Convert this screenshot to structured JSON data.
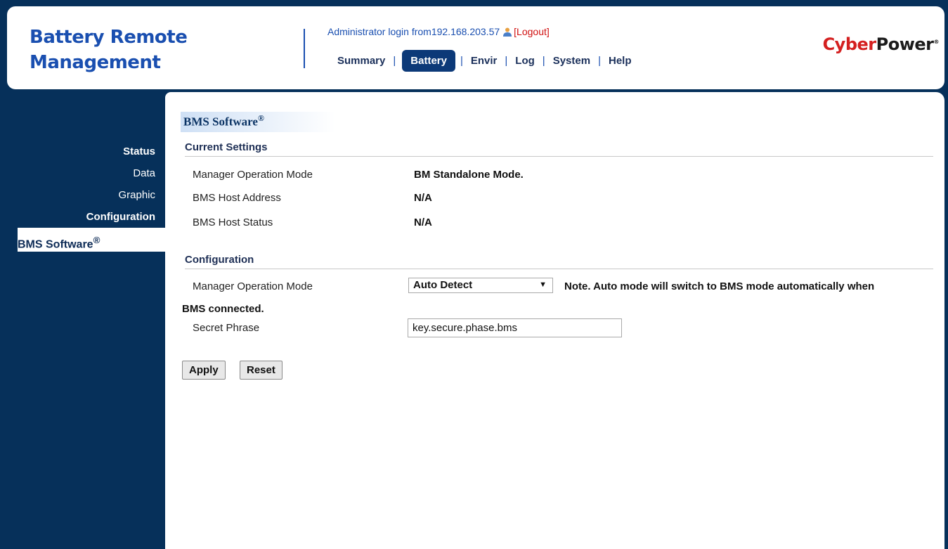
{
  "header": {
    "brand_line1": "Battery Remote",
    "brand_line2": "Management",
    "login_text": "Administrator login from192.168.203.57",
    "logout_label": "[Logout]",
    "logo_cyber": "Cyber",
    "logo_power": "Power",
    "logo_mark": "®"
  },
  "nav": {
    "summary": "Summary",
    "battery": "Battery",
    "envir": "Envir",
    "log": "Log",
    "system": "System",
    "help": "Help",
    "separator": "|"
  },
  "sidebar": {
    "status": "Status",
    "data": "Data",
    "graphic": "Graphic",
    "configuration": "Configuration",
    "bms_software": "BMS Software",
    "reg": "®"
  },
  "content": {
    "title": "BMS Software",
    "title_reg": "®",
    "current_settings": {
      "heading": "Current Settings",
      "rows": [
        {
          "label": "Manager Operation Mode",
          "value": "BM Standalone Mode."
        },
        {
          "label": "BMS Host Address",
          "value": "N/A"
        },
        {
          "label": "BMS Host Status",
          "value": "N/A"
        }
      ]
    },
    "configuration": {
      "heading": "Configuration",
      "mode_label": "Manager Operation Mode",
      "mode_selected": "Auto Detect",
      "note_line1": "Note. Auto mode will switch to BMS mode automatically when",
      "note_line2": "BMS connected.",
      "secret_label": "Secret Phrase",
      "secret_value": "key.secure.phase.bms"
    },
    "apply_label": "Apply",
    "reset_label": "Reset"
  },
  "colors": {
    "background": "#06305a",
    "brand_blue": "#1a4fb0",
    "active_tab": "#0c3978",
    "logout_red": "#d01010"
  }
}
